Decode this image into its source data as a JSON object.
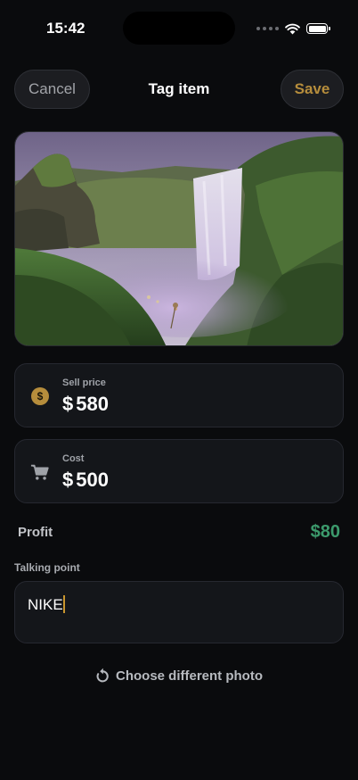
{
  "status_bar": {
    "time": "15:42"
  },
  "header": {
    "cancel_label": "Cancel",
    "title": "Tag item",
    "save_label": "Save"
  },
  "photo": {
    "icon": "photo-waterfall"
  },
  "sell_price": {
    "label": "Sell price",
    "currency": "$",
    "amount": "580",
    "icon": "dollar-coin-icon"
  },
  "cost": {
    "label": "Cost",
    "currency": "$",
    "amount": "500",
    "icon": "cart-icon"
  },
  "profit": {
    "label": "Profit",
    "value": "$80"
  },
  "talking_point": {
    "label": "Talking point",
    "value": "NIKE"
  },
  "choose_photo": {
    "label": "Choose different photo",
    "icon": "rotate-ccw-icon"
  },
  "colors": {
    "background": "#0a0b0d",
    "accent": "#b68d3c",
    "profit": "#3c9a6c",
    "card": "#14161a"
  }
}
